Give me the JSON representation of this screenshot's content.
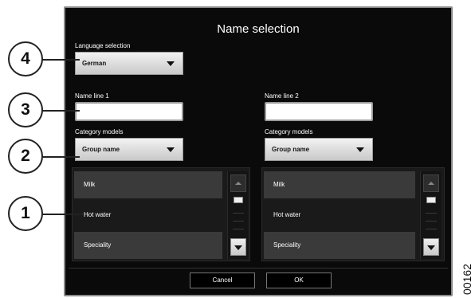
{
  "dialog": {
    "title": "Name selection",
    "language_label": "Language selection",
    "language_value": "German",
    "name_line_1_label": "Name line 1",
    "name_line_2_label": "Name line 2",
    "name_line_1_value": "",
    "name_line_2_value": "",
    "category_label_left": "Category models",
    "category_label_right": "Category models",
    "category_value_left": "Group name",
    "category_value_right": "Group name",
    "list_left": [
      "Milk",
      "Hot water",
      "Speciality"
    ],
    "list_right": [
      "Milk",
      "Hot water",
      "Speciality"
    ],
    "cancel_label": "Cancel",
    "ok_label": "OK"
  },
  "callouts": [
    "4",
    "3",
    "2",
    "1"
  ],
  "figure_code": "00162",
  "colors": {
    "screen_bg": "#0a0a0a",
    "list_shaded": "#3a3a3a",
    "dropdown_light": "#f2f2f2"
  },
  "icons": [
    "chevron-down-icon",
    "scroll-up-icon",
    "scroll-down-icon"
  ]
}
